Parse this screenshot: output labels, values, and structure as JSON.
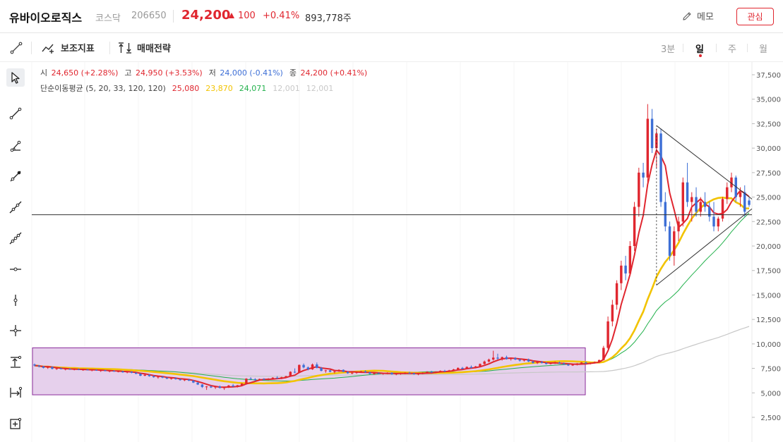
{
  "header": {
    "stock_name": "유바이오로직스",
    "market": "코스닥",
    "code": "206650",
    "price": "24,200",
    "change": "100",
    "change_pct": "+0.41%",
    "volume": "893,778주",
    "memo_label": "메모",
    "watch_label": "관심"
  },
  "toolbar": {
    "indicator_label": "보조지표",
    "strategy_label": "매매전략",
    "timeframes": [
      "3분",
      "일",
      "주",
      "월"
    ],
    "active_timeframe": "일"
  },
  "legend": {
    "open_label": "시",
    "open_value": "24,650 (+2.28%)",
    "high_label": "고",
    "high_value": "24,950 (+3.53%)",
    "low_label": "저",
    "low_value": "24,000 (-0.41%)",
    "close_label": "종",
    "close_value": "24,200 (+0.41%)",
    "ma_label": "단순이동평균 (5, 20, 33, 120, 120)",
    "ma_values": [
      {
        "value": "25,080",
        "color": "#e0262f"
      },
      {
        "value": "23,870",
        "color": "#f2c300"
      },
      {
        "value": "24,071",
        "color": "#22b14c"
      },
      {
        "value": "12,001",
        "color": "#c8c8c8"
      },
      {
        "value": "12,001",
        "color": "#c8c8c8"
      }
    ]
  },
  "tools": [
    {
      "name": "cursor-tool-icon",
      "active": true
    },
    {
      "name": "line-tool-icon"
    },
    {
      "name": "angle-line-tool-icon"
    },
    {
      "name": "ray-tool-icon"
    },
    {
      "name": "extended-line-tool-icon"
    },
    {
      "name": "trend-channel-tool-icon"
    },
    {
      "name": "horizontal-line-tool-icon"
    },
    {
      "name": "vertical-line-tool-icon"
    },
    {
      "name": "crosshair-line-tool-icon"
    },
    {
      "name": "price-range-tool-icon"
    },
    {
      "name": "date-range-tool-icon"
    },
    {
      "name": "measure-box-tool-icon"
    }
  ],
  "colors": {
    "up": "#e0262f",
    "down": "#3d6fd6",
    "ma5": "#e0262f",
    "ma20": "#f2c300",
    "ma33": "#22b14c",
    "ma120": "#c8c8c8",
    "box_fill": "#e6d0ec",
    "box_border": "#8a2b9a"
  },
  "chart_data": {
    "type": "candlestick",
    "y_ticks": [
      "37,500",
      "35,000",
      "32,500",
      "30,000",
      "27,500",
      "25,000",
      "22,500",
      "20,000",
      "17,500",
      "15,000",
      "12,500",
      "10,000",
      "7,500",
      "5,000",
      "2,500"
    ],
    "ylim": [
      0,
      38000
    ],
    "horizontal_line_price": 23200,
    "range_box": {
      "price_low": 4800,
      "price_high": 9600
    },
    "candles": [
      [
        7900,
        8000,
        7700,
        7800
      ],
      [
        7800,
        7850,
        7600,
        7700
      ],
      [
        7700,
        7750,
        7500,
        7550
      ],
      [
        7550,
        7700,
        7450,
        7650
      ],
      [
        7650,
        7700,
        7400,
        7450
      ],
      [
        7450,
        7550,
        7350,
        7500
      ],
      [
        7500,
        7600,
        7400,
        7420
      ],
      [
        7420,
        7500,
        7300,
        7450
      ],
      [
        7450,
        7500,
        7350,
        7380
      ],
      [
        7380,
        7450,
        7300,
        7420
      ],
      [
        7420,
        7480,
        7320,
        7350
      ],
      [
        7350,
        7400,
        7250,
        7380
      ],
      [
        7380,
        7450,
        7300,
        7320
      ],
      [
        7320,
        7380,
        7200,
        7350
      ],
      [
        7350,
        7400,
        7250,
        7280
      ],
      [
        7280,
        7320,
        7150,
        7300
      ],
      [
        7300,
        7350,
        7200,
        7220
      ],
      [
        7220,
        7300,
        7100,
        7250
      ],
      [
        7250,
        7300,
        7150,
        7180
      ],
      [
        7180,
        7250,
        7100,
        7200
      ],
      [
        7200,
        7250,
        7050,
        7100
      ],
      [
        7100,
        7200,
        7000,
        7150
      ],
      [
        7150,
        7200,
        7000,
        7050
      ],
      [
        7050,
        7100,
        6900,
        6950
      ],
      [
        6950,
        7000,
        6700,
        6750
      ],
      [
        6750,
        6900,
        6700,
        6850
      ],
      [
        6850,
        6900,
        6650,
        6700
      ],
      [
        6700,
        6800,
        6550,
        6600
      ],
      [
        6600,
        6700,
        6450,
        6650
      ],
      [
        6650,
        6700,
        6500,
        6550
      ],
      [
        6550,
        6600,
        6400,
        6450
      ],
      [
        6450,
        6550,
        6350,
        6500
      ],
      [
        6500,
        6550,
        6350,
        6400
      ],
      [
        6400,
        6450,
        6250,
        6300
      ],
      [
        6300,
        6400,
        6200,
        6350
      ],
      [
        6350,
        6400,
        6200,
        6250
      ],
      [
        6250,
        6300,
        6000,
        6050
      ],
      [
        6050,
        6100,
        5800,
        5850
      ],
      [
        5850,
        5900,
        5500,
        5600
      ],
      [
        5600,
        5700,
        5300,
        5650
      ],
      [
        5650,
        5750,
        5500,
        5550
      ],
      [
        5550,
        5700,
        5400,
        5650
      ],
      [
        5650,
        5750,
        5450,
        5500
      ],
      [
        5500,
        5600,
        5300,
        5550
      ],
      [
        5550,
        5800,
        5500,
        5750
      ],
      [
        5750,
        5900,
        5600,
        5650
      ],
      [
        5650,
        5800,
        5550,
        5780
      ],
      [
        5780,
        6000,
        5700,
        5950
      ],
      [
        5950,
        6500,
        5900,
        6450
      ],
      [
        6450,
        6600,
        6300,
        6400
      ],
      [
        6400,
        6500,
        6200,
        6300
      ],
      [
        6300,
        6450,
        6250,
        6420
      ],
      [
        6420,
        6500,
        6300,
        6350
      ],
      [
        6350,
        6500,
        6300,
        6450
      ],
      [
        6450,
        6600,
        6350,
        6550
      ],
      [
        6550,
        6700,
        6450,
        6500
      ],
      [
        6500,
        6650,
        6400,
        6600
      ],
      [
        6600,
        6750,
        6500,
        6700
      ],
      [
        6700,
        7200,
        6650,
        7150
      ],
      [
        7150,
        7500,
        7000,
        7100
      ],
      [
        7100,
        7900,
        7050,
        7850
      ],
      [
        7850,
        8000,
        7500,
        7600
      ],
      [
        7600,
        7700,
        7300,
        7400
      ],
      [
        7400,
        8000,
        7350,
        7900
      ],
      [
        7900,
        8100,
        7500,
        7550
      ],
      [
        7550,
        7650,
        7200,
        7250
      ],
      [
        7250,
        7350,
        7050,
        7300
      ],
      [
        7300,
        7350,
        7100,
        7150
      ],
      [
        7150,
        7250,
        7000,
        7200
      ],
      [
        7200,
        7400,
        7150,
        7350
      ],
      [
        7350,
        7400,
        7100,
        7150
      ],
      [
        7150,
        7200,
        6950,
        7000
      ],
      [
        7000,
        7100,
        6900,
        7050
      ],
      [
        7050,
        7150,
        6950,
        7100
      ],
      [
        7100,
        7250,
        7050,
        7200
      ],
      [
        7200,
        7300,
        7050,
        7100
      ],
      [
        7100,
        7150,
        6900,
        6950
      ],
      [
        6950,
        7050,
        6850,
        7000
      ],
      [
        7000,
        7100,
        6900,
        6950
      ],
      [
        6950,
        7050,
        6850,
        7000
      ],
      [
        7000,
        7100,
        6900,
        7050
      ],
      [
        7050,
        7100,
        6850,
        6900
      ],
      [
        6900,
        7000,
        6800,
        6950
      ],
      [
        6950,
        7050,
        6850,
        7000
      ],
      [
        7000,
        7100,
        6900,
        7050
      ],
      [
        7050,
        7150,
        6950,
        7000
      ],
      [
        7000,
        7050,
        6850,
        6900
      ],
      [
        6900,
        7000,
        6800,
        6950
      ],
      [
        6950,
        7100,
        6900,
        7050
      ],
      [
        7050,
        7200,
        7000,
        7150
      ],
      [
        7150,
        7250,
        7050,
        7100
      ],
      [
        7100,
        7200,
        7000,
        7180
      ],
      [
        7180,
        7300,
        7100,
        7250
      ],
      [
        7250,
        7350,
        7150,
        7200
      ],
      [
        7200,
        7350,
        7150,
        7300
      ],
      [
        7300,
        7450,
        7250,
        7400
      ],
      [
        7400,
        7600,
        7350,
        7550
      ],
      [
        7550,
        7650,
        7400,
        7450
      ],
      [
        7450,
        7700,
        7400,
        7650
      ],
      [
        7650,
        7800,
        7500,
        7550
      ],
      [
        7550,
        7750,
        7500,
        7700
      ],
      [
        7700,
        8000,
        7650,
        7950
      ],
      [
        7950,
        8300,
        7900,
        8200
      ],
      [
        8200,
        8500,
        8100,
        8400
      ],
      [
        8400,
        9300,
        8300,
        8600
      ],
      [
        8600,
        9000,
        8400,
        8500
      ],
      [
        8500,
        8700,
        8300,
        8650
      ],
      [
        8650,
        8800,
        8400,
        8450
      ],
      [
        8450,
        8600,
        8300,
        8550
      ],
      [
        8550,
        8650,
        8350,
        8400
      ],
      [
        8400,
        8500,
        8200,
        8300
      ],
      [
        8300,
        8450,
        8200,
        8400
      ],
      [
        8400,
        8500,
        8150,
        8200
      ],
      [
        8200,
        8300,
        8000,
        8050
      ],
      [
        8050,
        8200,
        7950,
        8150
      ],
      [
        8150,
        8250,
        8000,
        8050
      ],
      [
        8050,
        8150,
        7900,
        7950
      ],
      [
        7950,
        8100,
        7900,
        8050
      ],
      [
        8050,
        8200,
        7950,
        8100
      ],
      [
        8100,
        8200,
        7950,
        8000
      ],
      [
        8000,
        8100,
        7850,
        7900
      ],
      [
        7900,
        8000,
        7750,
        7800
      ],
      [
        7800,
        7950,
        7750,
        7900
      ],
      [
        7900,
        8050,
        7800,
        8000
      ],
      [
        8000,
        8150,
        7900,
        8100
      ],
      [
        8100,
        8200,
        7950,
        8000
      ],
      [
        8000,
        8100,
        7900,
        8050
      ],
      [
        8050,
        8200,
        8000,
        8150
      ],
      [
        8150,
        8400,
        8100,
        8350
      ],
      [
        8350,
        9800,
        8300,
        9600
      ],
      [
        9600,
        12800,
        9500,
        12300
      ],
      [
        12300,
        14500,
        11800,
        14000
      ],
      [
        14000,
        16500,
        13500,
        16200
      ],
      [
        16200,
        18500,
        15500,
        18000
      ],
      [
        18000,
        19000,
        16500,
        17200
      ],
      [
        17200,
        20500,
        17000,
        20000
      ],
      [
        20000,
        24500,
        19500,
        24000
      ],
      [
        24000,
        28000,
        23000,
        27500
      ],
      [
        27500,
        28500,
        26000,
        27000
      ],
      [
        27000,
        34500,
        26500,
        33000
      ],
      [
        33000,
        34000,
        29500,
        30000
      ],
      [
        30000,
        32000,
        28000,
        31500
      ],
      [
        31500,
        32000,
        24000,
        24500
      ],
      [
        24500,
        25500,
        21500,
        22000
      ],
      [
        22000,
        22500,
        18500,
        19000
      ],
      [
        19000,
        22000,
        18000,
        21500
      ],
      [
        21500,
        23000,
        20500,
        22500
      ],
      [
        22500,
        27000,
        22000,
        26500
      ],
      [
        26500,
        28500,
        24000,
        24500
      ],
      [
        24500,
        25500,
        22500,
        25000
      ],
      [
        25000,
        26000,
        23000,
        23500
      ],
      [
        23500,
        25000,
        23000,
        24500
      ],
      [
        24500,
        25500,
        23500,
        24000
      ],
      [
        24000,
        24500,
        22500,
        23000
      ],
      [
        23000,
        24500,
        21500,
        22000
      ],
      [
        22000,
        23000,
        21500,
        22800
      ],
      [
        22800,
        25000,
        22500,
        24800
      ],
      [
        24800,
        26500,
        24300,
        26000
      ],
      [
        26000,
        27500,
        25500,
        27000
      ],
      [
        27000,
        27200,
        24500,
        25000
      ],
      [
        25000,
        26000,
        24000,
        25500
      ],
      [
        25500,
        26200,
        23000,
        23500
      ],
      [
        24650,
        24950,
        24000,
        24200
      ]
    ]
  }
}
